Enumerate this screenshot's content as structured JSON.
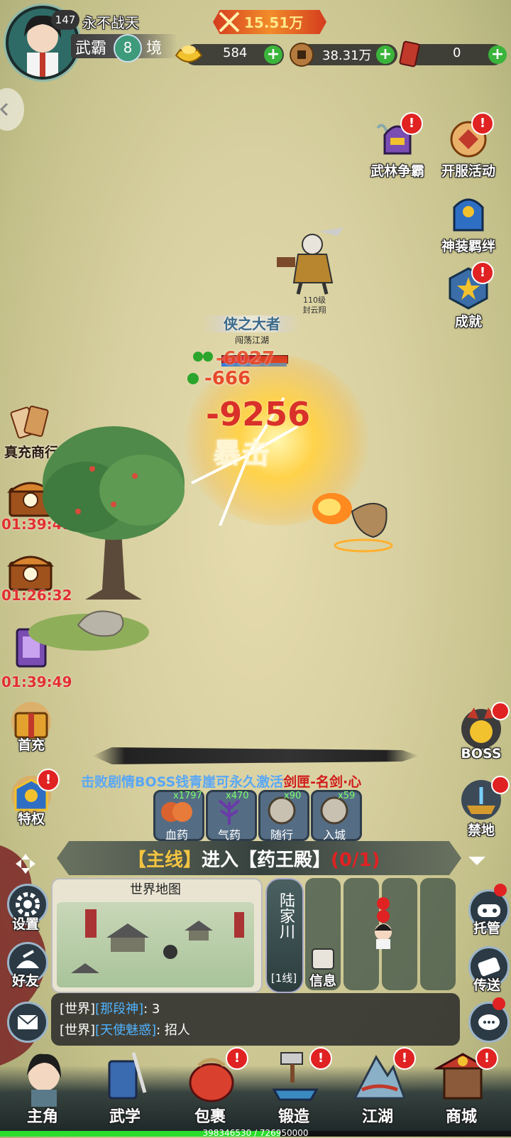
{
  "player": {
    "level": "147",
    "name": "永不战天",
    "realm_prefix": "武霸",
    "realm_num": "8",
    "realm_suffix": "境"
  },
  "power": "15.51万",
  "currencies": [
    {
      "icon": "gold-ingot-icon",
      "value": "584"
    },
    {
      "icon": "copper-coin-icon",
      "value": "38.31万"
    },
    {
      "icon": "ticket-icon",
      "value": "0"
    }
  ],
  "right_icons": [
    {
      "label": "武林争霸"
    },
    {
      "label": "开服活动"
    },
    {
      "label": "神装羁绊"
    },
    {
      "label": "成就"
    }
  ],
  "left_icons": {
    "shop": "真充商行",
    "timer1": "01:39:49",
    "timer2": "01:26:32",
    "timer3": "01:39:49",
    "first_charge": "首充",
    "privilege": "特权"
  },
  "enemy": {
    "level": "110级",
    "name": "封云翔"
  },
  "title_banner": {
    "main": "侠之大者",
    "sub": "闯荡江湖"
  },
  "damage": {
    "big": "-9256",
    "small1": "-6027",
    "small2": "-666"
  },
  "crit_text": "暴击",
  "alert_symbol": "!",
  "right_lower": {
    "boss": "BOSS",
    "forbidden": "禁地",
    "auto": "托管",
    "teleport": "传送"
  },
  "boss_message": {
    "prefix": "击败剧情BOSS钱青崖可永久激活",
    "highlight": "剑匣-名剑·心"
  },
  "items": [
    {
      "name": "血药",
      "count": "x1797"
    },
    {
      "name": "气药",
      "count": "x470"
    },
    {
      "name": "随行",
      "count": "x90"
    },
    {
      "name": "入城",
      "count": "x59"
    }
  ],
  "quest": {
    "tag": "【主线】",
    "text": "进入【药王殿】",
    "progress": "(0/1)"
  },
  "left_lower": {
    "settings": "设置",
    "friends": "好友"
  },
  "map": {
    "title": "世界地图"
  },
  "location": {
    "name": "陆家川",
    "line": "[1线]"
  },
  "info_label": "信息",
  "chat": [
    {
      "channel": "[世界]",
      "name": "[那段神]",
      "text": ": 3"
    },
    {
      "channel": "[世界]",
      "name": "[天使魅惑]",
      "text": ": 招人"
    }
  ],
  "nav": [
    {
      "label": "主角"
    },
    {
      "label": "武学"
    },
    {
      "label": "包裹"
    },
    {
      "label": "锻造"
    },
    {
      "label": "江湖"
    },
    {
      "label": "商城"
    }
  ],
  "exp": {
    "text": "398346530 / 726950000",
    "fraction": 0.548
  }
}
